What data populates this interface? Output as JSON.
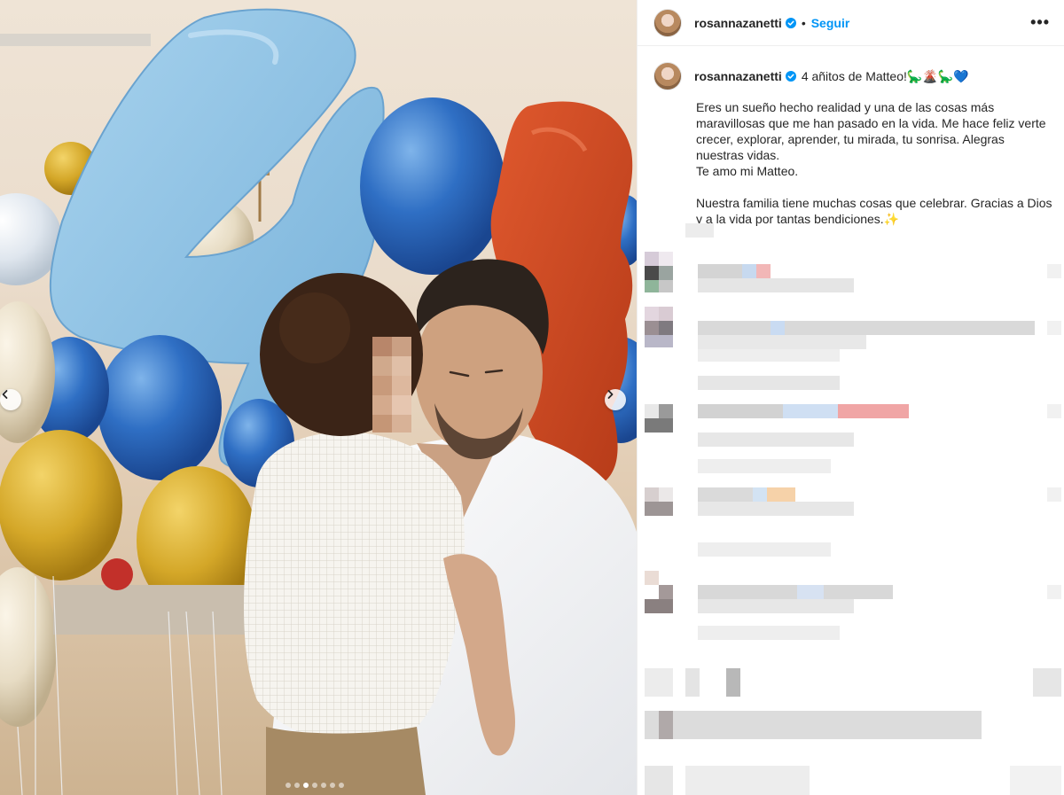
{
  "post": {
    "username": "rosannazanetti",
    "follow_label": "Seguir",
    "more_label": "•••",
    "caption_title": "4 añitos de Matteo!🦕🌋🦕💙",
    "caption_paragraph_1": "Eres un sueño hecho realidad y una de las cosas más maravillosas que me han pasado en la vida. Me hace feliz verte crecer, explorar, aprender, tu mirada, tu sonrisa. Alegras nuestras vidas.\nTe amo mi Matteo.",
    "caption_paragraph_2": "Nuestra familia tiene muchas cosas que celebrar. Gracias a Dios y a la vida por tantas bendiciones.✨"
  },
  "carousel": {
    "prev_icon": "chevron-left-icon",
    "next_icon": "chevron-right-icon",
    "total_slides": 7,
    "active_slide": 3
  },
  "colors": {
    "accent": "#0095f6",
    "verified": "#0095f6",
    "text": "#262626"
  }
}
